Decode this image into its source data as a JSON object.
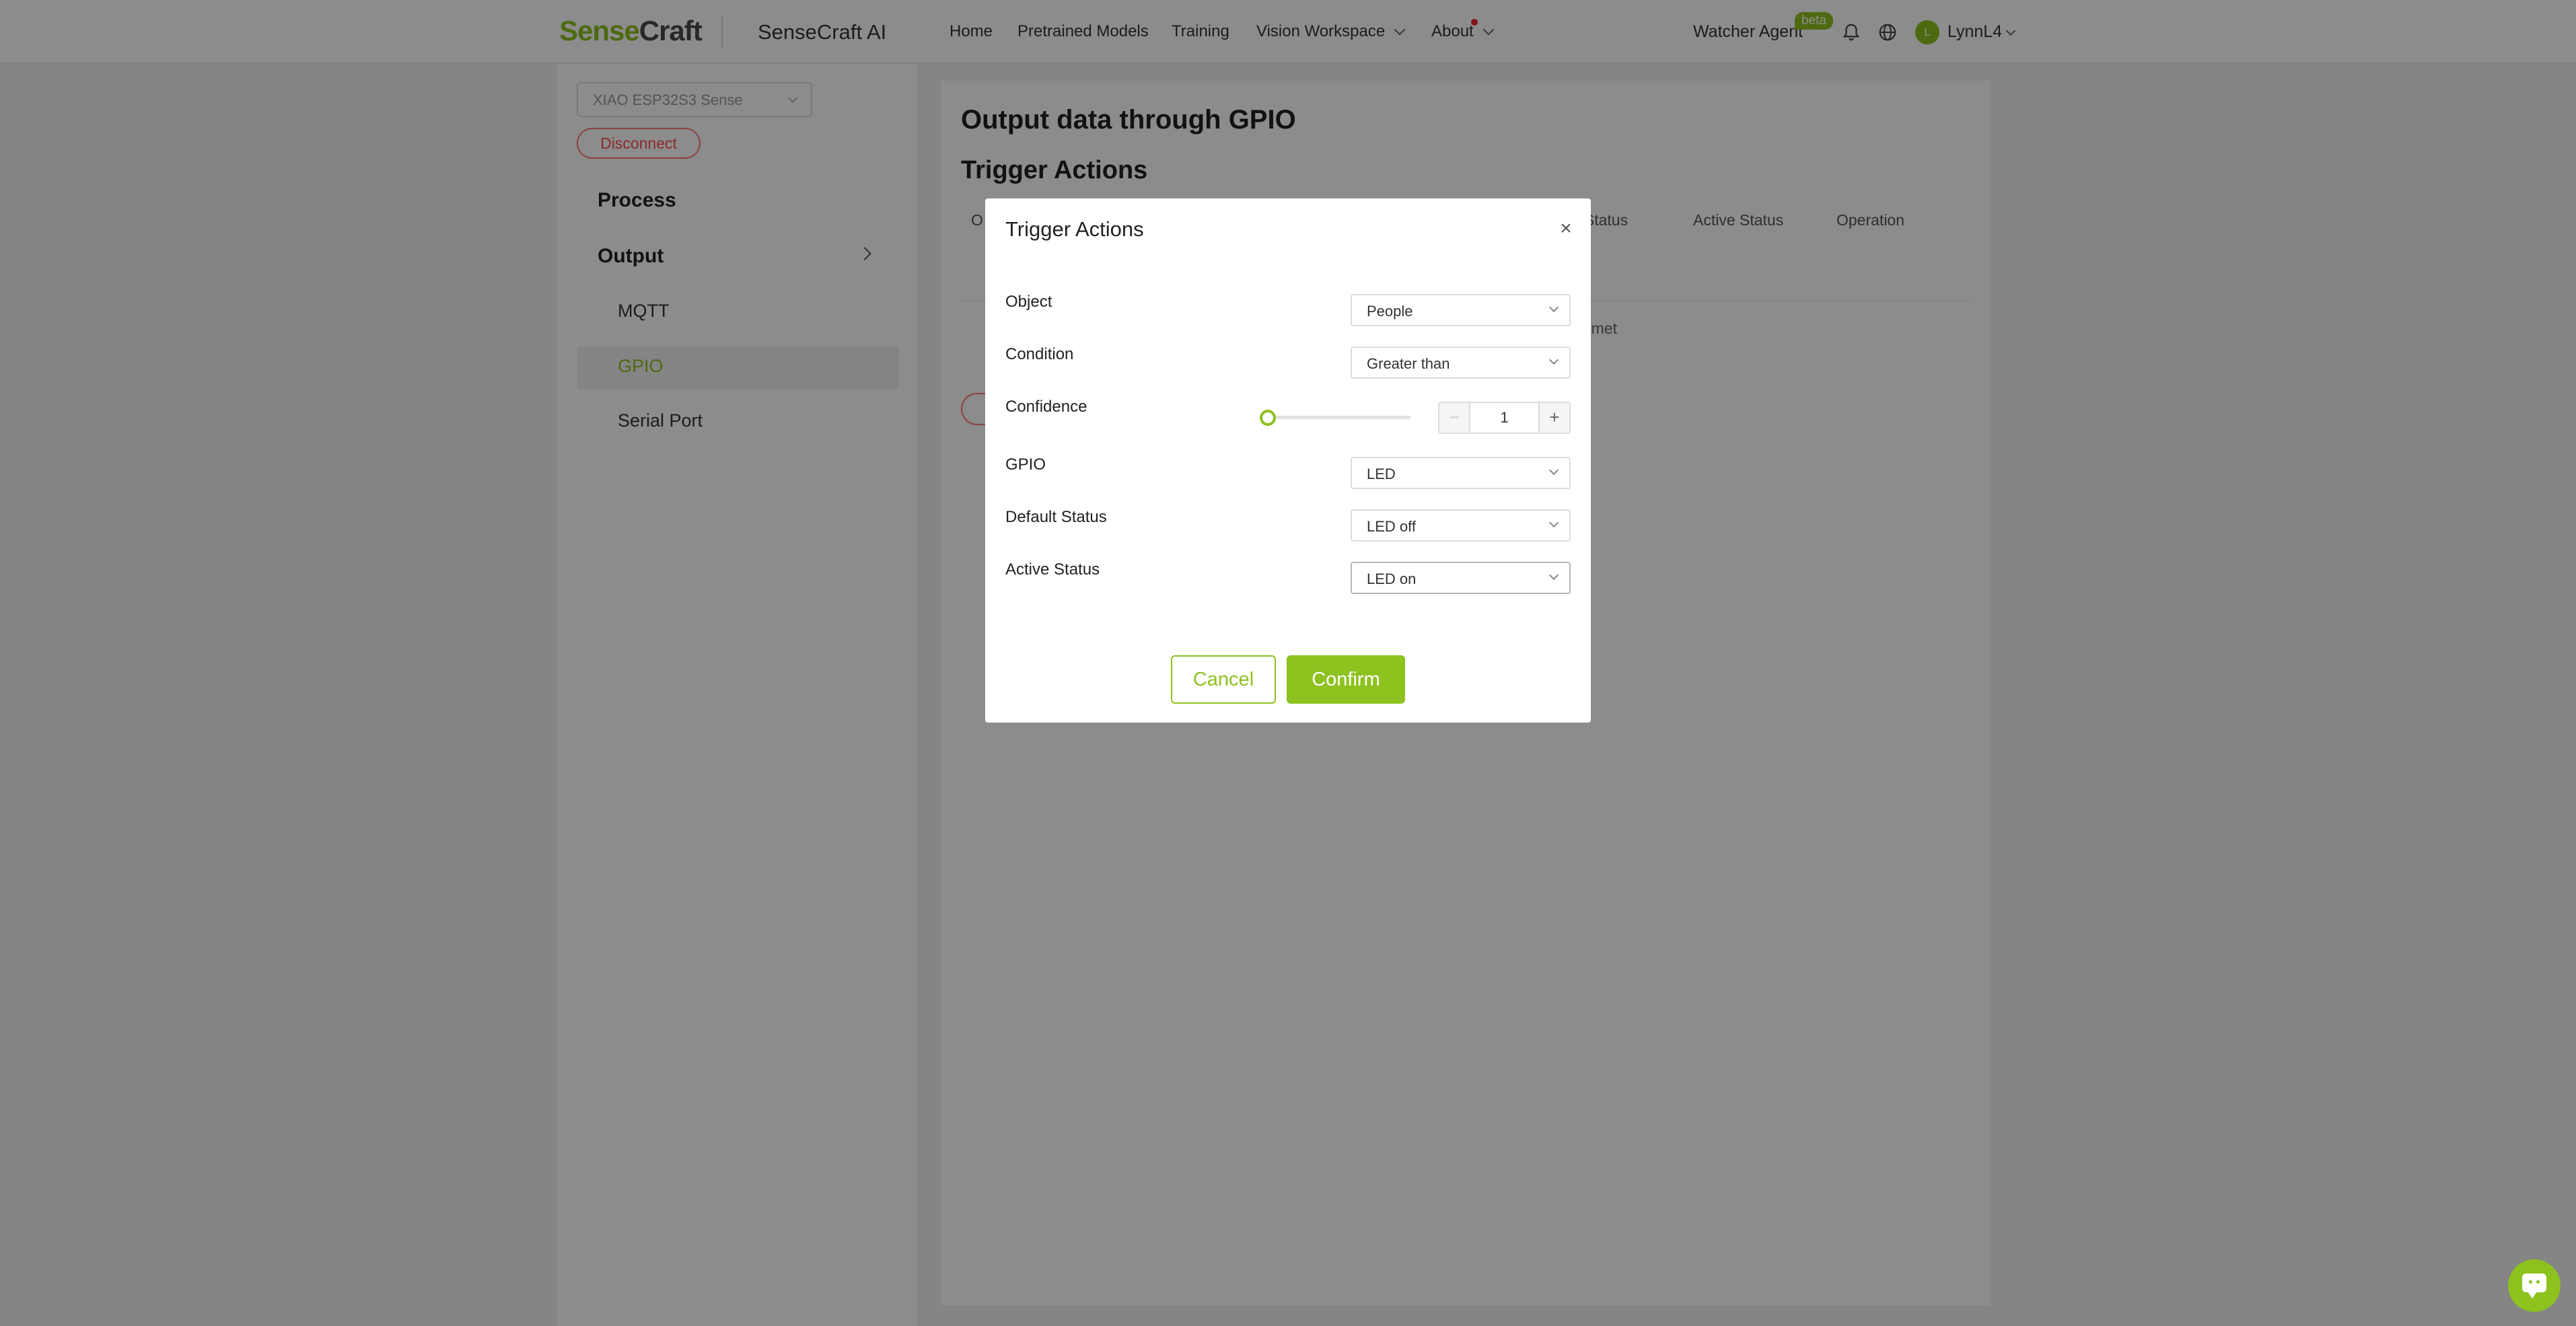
{
  "header": {
    "logo_part1": "Sense",
    "logo_part2": "Craft",
    "product_name": "SenseCraft AI",
    "nav": [
      "Home",
      "Pretrained Models",
      "Training",
      "Vision Workspace",
      "About"
    ],
    "agent_label": "Watcher Agent",
    "agent_badge": "beta",
    "avatar_initial": "L",
    "user_name": "LynnL4",
    "icons": [
      "bell-icon",
      "globe-icon"
    ]
  },
  "sidebar": {
    "device": "XIAO ESP32S3 Sense",
    "disconnect_label": "Disconnect",
    "process_label": "Process",
    "output_label": "Output",
    "items": [
      "MQTT",
      "GPIO",
      "Serial Port"
    ],
    "active_item": "GPIO"
  },
  "main": {
    "title": "Output data through GPIO",
    "subtitle": "Trigger Actions",
    "columns_visible": [
      "O",
      "lt Status",
      "Active Status",
      "Operation"
    ],
    "empty_text_fragment": "are met"
  },
  "modal": {
    "title": "Trigger Actions",
    "fields": {
      "object": {
        "label": "Object",
        "value": "People"
      },
      "condition": {
        "label": "Condition",
        "value": "Greater than"
      },
      "confidence": {
        "label": "Confidence",
        "value": "1",
        "slider_fraction": 0.0
      },
      "gpio": {
        "label": "GPIO",
        "value": "LED"
      },
      "default_status": {
        "label": "Default Status",
        "value": "LED off"
      },
      "active_status": {
        "label": "Active Status",
        "value": "LED on"
      }
    },
    "cancel_label": "Cancel",
    "confirm_label": "Confirm"
  },
  "colors": {
    "accent": "#8dc21f",
    "danger": "#ff4d4f",
    "overlay": "rgba(0,0,0,0.45)"
  }
}
